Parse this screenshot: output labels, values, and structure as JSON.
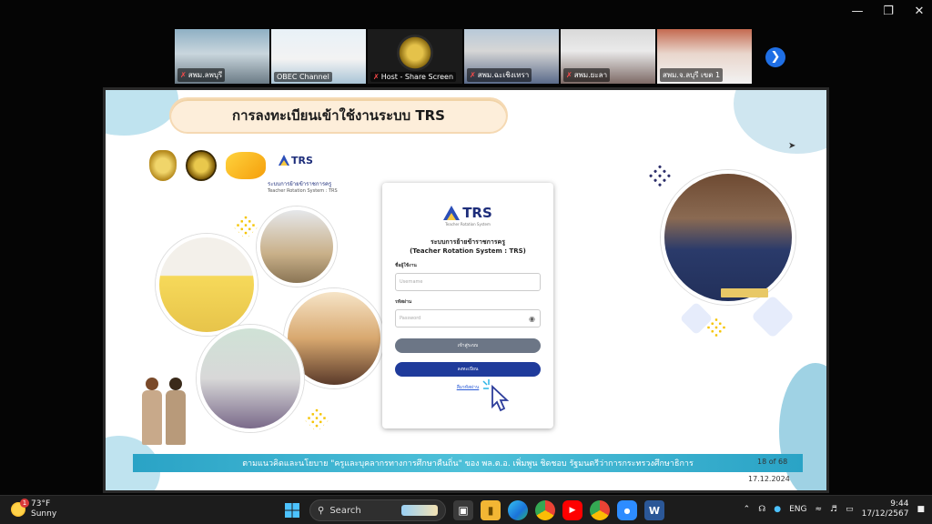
{
  "participants": [
    {
      "name": "สพม.ลพบุรี",
      "muted": true
    },
    {
      "name": "OBEC Channel",
      "muted": false,
      "active": true
    },
    {
      "name": "Host - Share Screen",
      "muted": true
    },
    {
      "name": "สพม.ฉะเชิงเทรา",
      "muted": true
    },
    {
      "name": "สพม.ยะลา",
      "muted": true
    },
    {
      "name": "สพม.จ.ลบุรี เขต 1",
      "muted": false
    }
  ],
  "slide": {
    "title": "การลงทะเบียนเข้าใช้งานระบบ TRS",
    "trs_mark": "TRS",
    "trs_caption_th": "ระบบการย้ายข้าราชการครู",
    "trs_caption_en": "Teacher Rotation System : TRS",
    "footer": "ตามแนวคิดและนโยบาย \"ครูและบุคลากรทางการศึกษาคืนถิ่น\" ของ พล.ต.อ. เพิ่มพูน ชิดชอบ รัฐมนตรีว่าการกระทรวงศึกษาธิการ",
    "page": "18 of 68",
    "date": "17.12.2024"
  },
  "login": {
    "logo": "TRS",
    "logo_sub": "Teacher Rotation System",
    "heading_th": "ระบบการย้ายข้าราชการครู",
    "heading_en": "(Teacher Rotation System : TRS)",
    "username_label": "ชื่อผู้ใช้งาน",
    "username_placeholder": "Username",
    "password_label": "รหัสผ่าน",
    "password_placeholder": "Password",
    "login_button": "เข้าสู่ระบบ",
    "register_button": "ลงทะเบียน",
    "forgot_link": "ลืมรหัสผ่าน"
  },
  "taskbar": {
    "temperature": "73°F",
    "weather": "Sunny",
    "weather_badge": "1",
    "search_placeholder": "Search",
    "language": "ENG",
    "time": "9:44",
    "date": "17/12/2567"
  },
  "colors": {
    "accent": "#1f3b9b",
    "active_tile": "#35d07f",
    "footer_band": "#2aa3c6",
    "taskbar": "#1c1c1c"
  }
}
